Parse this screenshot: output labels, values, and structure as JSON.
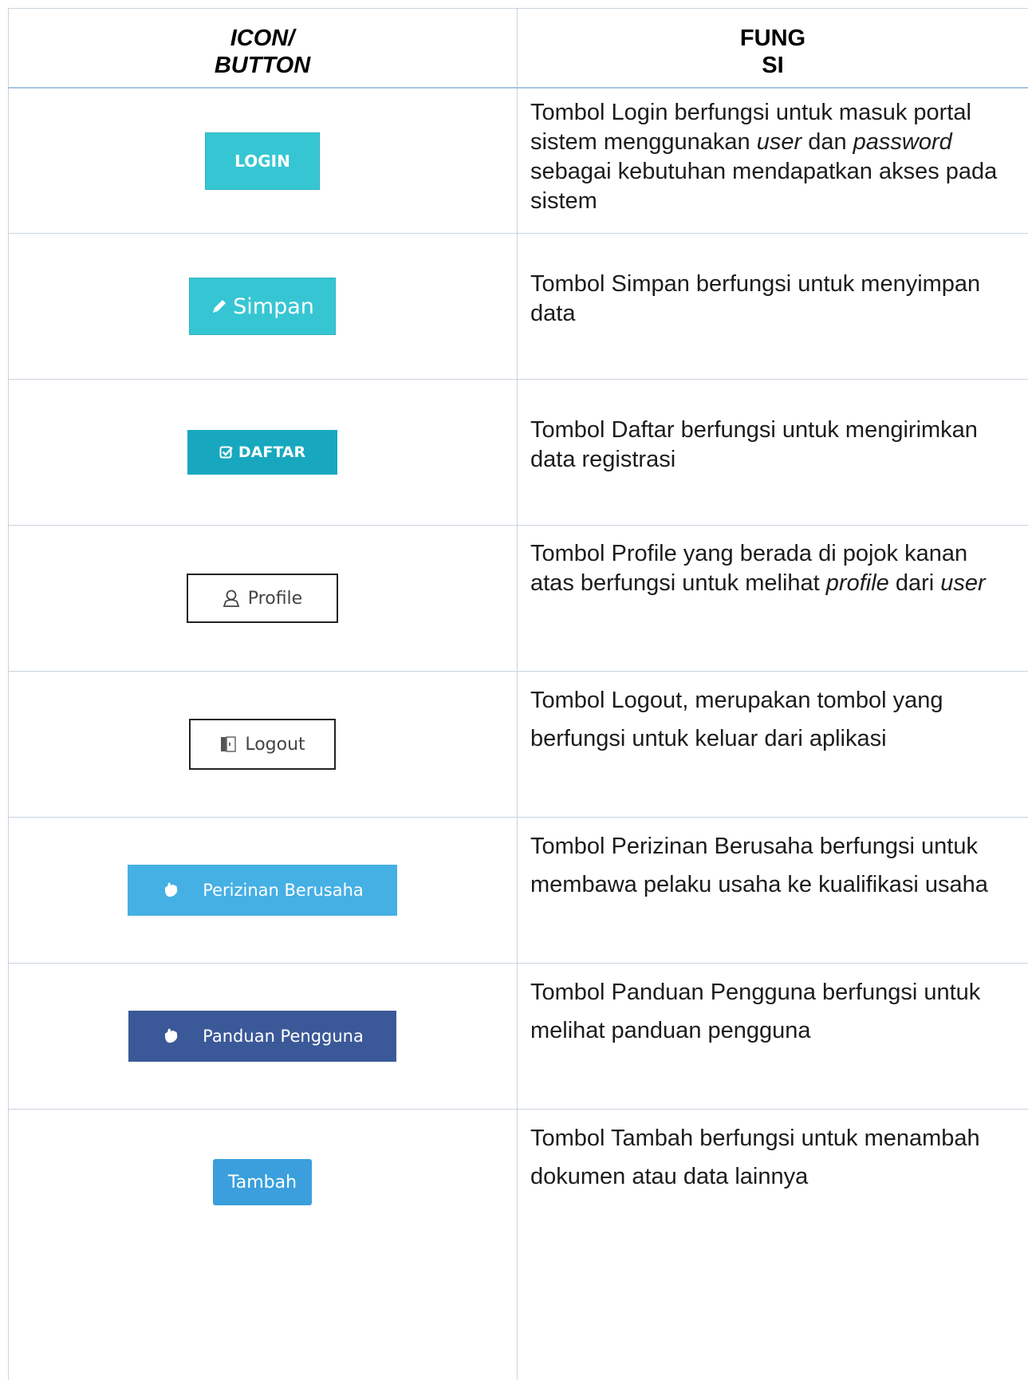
{
  "header": {
    "col1_line1": "ICON/",
    "col1_line2": "BUTTON",
    "col2_line1": "FUNG",
    "col2_line2": "SI"
  },
  "rows": [
    {
      "button_label": "LOGIN",
      "icon": "none",
      "desc": {
        "p1": "Tombol Login berfungsi untuk masuk portal sistem menggunakan ",
        "em1": "user",
        "p2": " dan ",
        "em2": "password",
        "p3": " sebagai kebutuhan mendapatkan akses pada sistem"
      }
    },
    {
      "button_label": "Simpan",
      "icon": "pencil-icon",
      "desc": {
        "p1": "Tombol Simpan berfungsi untuk menyimpan data"
      }
    },
    {
      "button_label": "DAFTAR",
      "icon": "check-square-icon",
      "desc": {
        "p1": "Tombol Daftar berfungsi untuk mengirimkan data registrasi"
      }
    },
    {
      "button_label": "Profile",
      "icon": "user-icon",
      "desc": {
        "p1": "Tombol Profile yang berada di pojok kanan atas berfungsi untuk melihat ",
        "em1": "profile",
        "p2": " dari ",
        "em2": "user"
      }
    },
    {
      "button_label": "Logout",
      "icon": "logout-icon",
      "desc": {
        "p1": "Tombol Logout, merupakan tombol yang berfungsi untuk keluar dari aplikasi"
      }
    },
    {
      "button_label": "Perizinan Berusaha",
      "icon": "hand-icon",
      "desc": {
        "p1": "Tombol Perizinan Berusaha berfungsi untuk membawa pelaku usaha ke kualifikasi usaha"
      }
    },
    {
      "button_label": "Panduan Pengguna",
      "icon": "hand-icon",
      "desc": {
        "p1": "Tombol Panduan Pengguna berfungsi untuk melihat panduan pengguna"
      }
    },
    {
      "button_label": "Tambah",
      "icon": "none",
      "desc": {
        "p1": "Tombol Tambah berfungsi untuk menambah dokumen atau data lainnya"
      }
    }
  ],
  "colors": {
    "login": "#36c6d3",
    "simpan": "#36c6d3",
    "daftar": "#17a8bf",
    "perizinan": "#45b0e4",
    "panduan": "#3b5998",
    "tambah": "#3a9fdc",
    "grid": "#c9d3de",
    "header_rule": "#a8c4e3"
  }
}
